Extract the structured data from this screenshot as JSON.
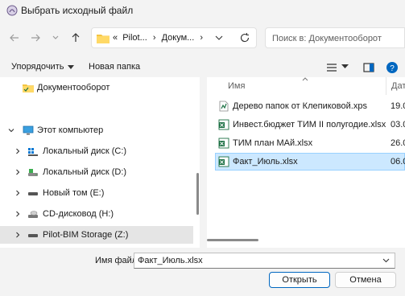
{
  "window": {
    "title": "Выбрать исходный файл"
  },
  "nav": {
    "breadcrumb_prefix": "«",
    "crumbs": [
      "Pilot...",
      "Докум..."
    ],
    "separator": "›",
    "search_placeholder": "Поиск в: Документооборот"
  },
  "toolbar": {
    "organize_label": "Упорядочить",
    "new_folder_label": "Новая папка"
  },
  "tree": {
    "items": [
      {
        "label": "Документооборот"
      },
      {
        "label": "Этот компьютер"
      },
      {
        "label": "Локальный диск (C:)"
      },
      {
        "label": "Локальный диск (D:)"
      },
      {
        "label": "Новый том (E:)"
      },
      {
        "label": "CD-дисковод (H:)"
      },
      {
        "label": "Pilot-BIM Storage (Z:)"
      }
    ]
  },
  "files": {
    "col_name": "Имя",
    "col_date": "Дата",
    "rows": [
      {
        "name": "Дерево папок от Клепиковой.xps",
        "date": "19.0"
      },
      {
        "name": "Инвест.бюджет ТИМ II полугодие.xlsx",
        "date": "03.0"
      },
      {
        "name": "ТИМ план МАй.xlsx",
        "date": "26.0"
      },
      {
        "name": "Факт_Июль.xlsx",
        "date": "06.0"
      }
    ]
  },
  "bottom": {
    "filename_label": "Имя файла:",
    "filename_value": "Факт_Июль.xlsx",
    "open_label": "Открыть",
    "cancel_label": "Отмена"
  },
  "colors": {
    "accent": "#0067c0",
    "selected_bg": "#cce8ff",
    "excel_green": "#1d7044",
    "folder_yellow": "#f4c542"
  }
}
